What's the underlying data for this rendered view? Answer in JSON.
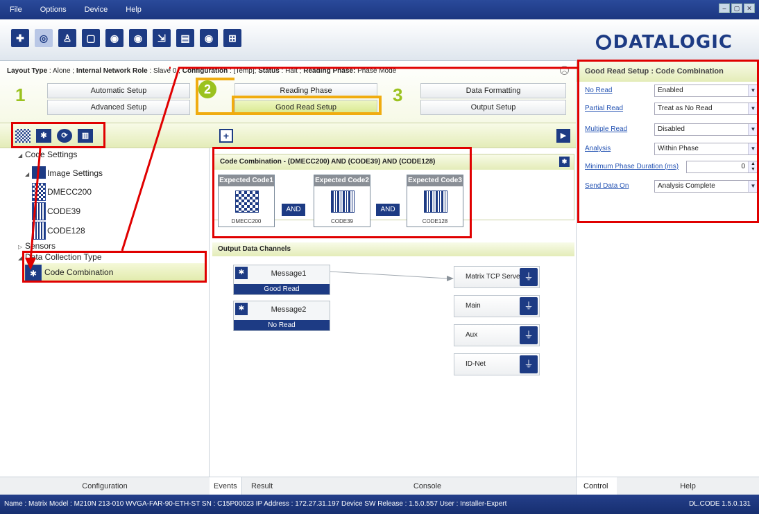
{
  "menu": [
    "File",
    "Options",
    "Device",
    "Help"
  ],
  "window_controls": [
    "–",
    "▢",
    "✕"
  ],
  "toolbar": {
    "icons": [
      "target-icon",
      "settings-icon",
      "user-icon",
      "window-icon",
      "capture-icon",
      "capture2-icon",
      "export-icon",
      "table-icon",
      "capture3-icon",
      "tree-icon"
    ],
    "logo_text": "DATALOGIC"
  },
  "info": {
    "layout_type_label": "Layout Type",
    "layout_type": "Alone",
    "network_role_label": "Internal Network Role",
    "network_role": "Slave 0",
    "configuration_label": "Configuration",
    "configuration": "[Temp]",
    "status_label": "Status",
    "status": "Halt",
    "reading_phase_label": "Reading Phase:",
    "reading_phase": "Phase Mode"
  },
  "steps": {
    "step1_num": "1",
    "step2_num": "2",
    "step3_num": "3",
    "automatic_setup": "Automatic Setup",
    "advanced_setup": "Advanced Setup",
    "reading_phase": "Reading Phase",
    "good_read_setup": "Good Read Setup",
    "data_formatting": "Data Formatting",
    "output_setup": "Output Setup"
  },
  "tree": {
    "code_settings": "Code Settings",
    "image_settings": "Image Settings",
    "codes": [
      "DMECC200",
      "CODE39",
      "CODE128"
    ],
    "sensors": "Sensors",
    "data_collection_type": "Data Collection Type",
    "code_combination": "Code Combination",
    "footer": "Configuration"
  },
  "code_combination": {
    "title": "Code Combination  -  (DMECC200) AND (CODE39) AND (CODE128)",
    "expected": [
      {
        "header": "Expected Code1",
        "name": "DMECC200",
        "kind": "matrix"
      },
      {
        "header": "Expected Code2",
        "name": "CODE39",
        "kind": "barcode"
      },
      {
        "header": "Expected Code3",
        "name": "CODE128",
        "kind": "barcode"
      }
    ],
    "operator": "AND"
  },
  "output_channels": {
    "title": "Output Data Channels",
    "messages": [
      {
        "name": "Message1",
        "state": "Good Read"
      },
      {
        "name": "Message2",
        "state": "No Read"
      }
    ],
    "channels": [
      "Matrix TCP Server",
      "Main",
      "Aux",
      "ID-Net"
    ]
  },
  "center_tabs": {
    "events": "Events",
    "result": "Result",
    "console": "Console"
  },
  "right_panel": {
    "title": "Good Read Setup : Code Combination",
    "rows": [
      {
        "label": "No Read",
        "value": "Enabled"
      },
      {
        "label": "Partial Read",
        "value": "Treat as No Read"
      },
      {
        "label": "Multiple Read",
        "value": "Disabled"
      },
      {
        "label": "Analysis",
        "value": "Within Phase"
      }
    ],
    "min_phase_label": "Minimum Phase Duration (ms)",
    "min_phase_value": "0",
    "send_data_label": "Send Data On",
    "send_data_value": "Analysis Complete",
    "control_tab": "Control",
    "help_tab": "Help"
  },
  "status_bar": {
    "text": "Name : Matrix  Model : M210N 213-010 WVGA-FAR-90-ETH-ST  SN : C15P00023  IP Address :  172.27.31.197  Device SW Release : 1.5.0.557  User : Installer-Expert",
    "version": "DL.CODE 1.5.0.131"
  },
  "colors": {
    "accent": "#1d3b84",
    "green": "#9bc21f",
    "highlight_red": "#e00000",
    "highlight_orange": "#f0ac10"
  }
}
